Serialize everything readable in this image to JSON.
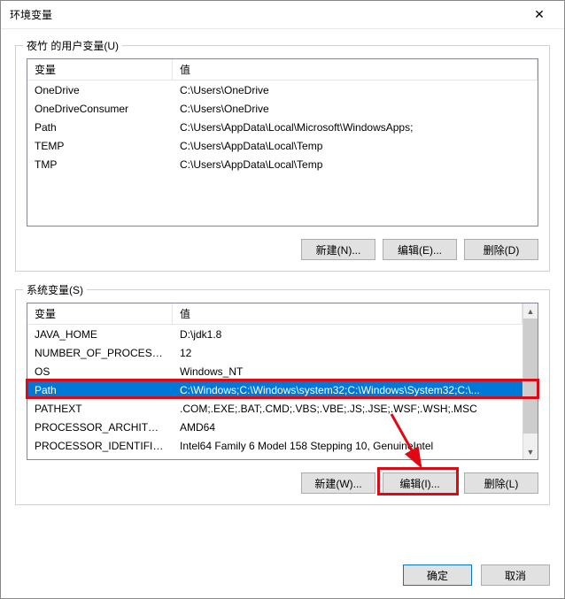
{
  "title": "环境变量",
  "close_icon": "✕",
  "user_section": {
    "legend": "夜竹 的用户变量(U)",
    "columns": {
      "var": "变量",
      "val": "值"
    },
    "rows": [
      {
        "var": "OneDrive",
        "val": "C:\\Users\\OneDrive"
      },
      {
        "var": "OneDriveConsumer",
        "val": "C:\\Users\\OneDrive"
      },
      {
        "var": "Path",
        "val": "C:\\Users\\AppData\\Local\\Microsoft\\WindowsApps;"
      },
      {
        "var": "TEMP",
        "val": "C:\\Users\\AppData\\Local\\Temp"
      },
      {
        "var": "TMP",
        "val": "C:\\Users\\AppData\\Local\\Temp"
      }
    ],
    "buttons": {
      "new": "新建(N)...",
      "edit": "编辑(E)...",
      "delete": "删除(D)"
    }
  },
  "sys_section": {
    "legend": "系统变量(S)",
    "columns": {
      "var": "变量",
      "val": "值"
    },
    "rows": [
      {
        "var": "JAVA_HOME",
        "val": "D:\\jdk1.8"
      },
      {
        "var": "NUMBER_OF_PROCESSORS",
        "val": "12"
      },
      {
        "var": "OS",
        "val": "Windows_NT"
      },
      {
        "var": "Path",
        "val": "C:\\Windows;C:\\Windows\\system32;C:\\Windows\\System32;C:\\...",
        "selected": true
      },
      {
        "var": "PATHEXT",
        "val": ".COM;.EXE;.BAT;.CMD;.VBS;.VBE;.JS;.JSE;.WSF;.WSH;.MSC"
      },
      {
        "var": "PROCESSOR_ARCHITECTURE",
        "val": "AMD64"
      },
      {
        "var": "PROCESSOR_IDENTIFIER",
        "val": "Intel64 Family 6 Model 158 Stepping 10, GenuineIntel"
      }
    ],
    "buttons": {
      "new": "新建(W)...",
      "edit": "编辑(I)...",
      "delete": "删除(L)"
    }
  },
  "footer": {
    "ok": "确定",
    "cancel": "取消"
  },
  "scroll_glyphs": {
    "up": "▲",
    "down": "▼"
  }
}
